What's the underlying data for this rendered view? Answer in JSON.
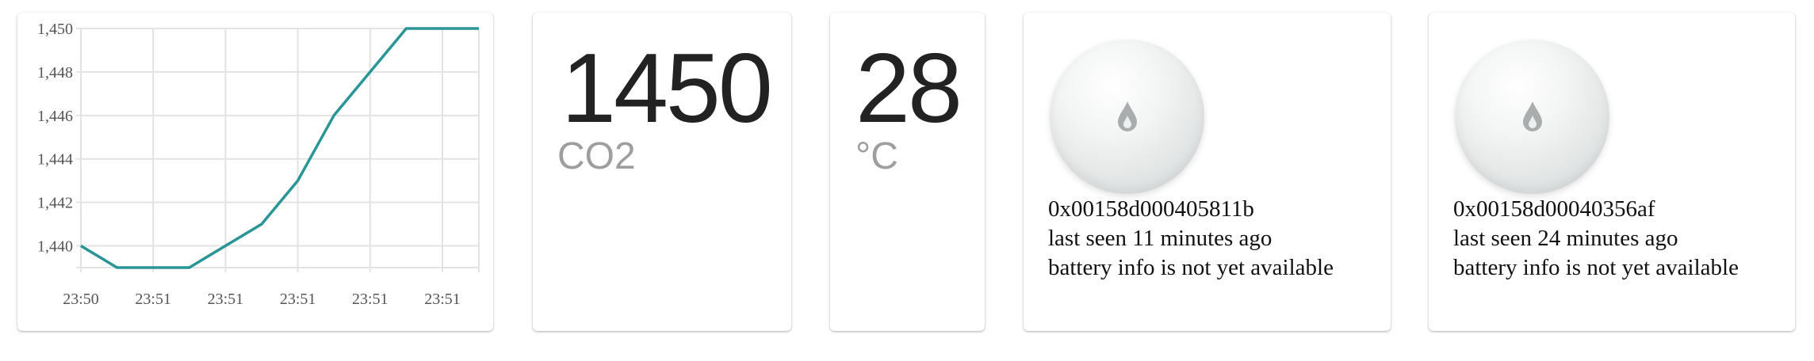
{
  "chart_data": {
    "type": "line",
    "x": [
      "23:50",
      "23:51",
      "23:51",
      "23:51",
      "23:51",
      "23:51"
    ],
    "series": [
      {
        "values": [
          1440,
          1439,
          1439,
          1439,
          1440,
          1441,
          1443,
          1446,
          1448,
          1450,
          1450
        ],
        "color": "#2a9596"
      }
    ],
    "ylim": [
      1439,
      1450
    ],
    "yticks": [
      "1,440",
      "1,442",
      "1,444",
      "1,446",
      "1,448",
      "1,450"
    ],
    "grid": true
  },
  "co2": {
    "value": "1450",
    "unit": "CO2"
  },
  "temperature": {
    "value": "28",
    "unit": "°C"
  },
  "sensors": [
    {
      "icon": "water-drop-icon",
      "id": "0x00158d000405811b",
      "last_seen": "last seen 11 minutes ago",
      "battery": "battery info is not yet available"
    },
    {
      "icon": "water-drop-icon",
      "id": "0x00158d00040356af",
      "last_seen": "last seen 24 minutes ago",
      "battery": "battery info is not yet available"
    }
  ]
}
